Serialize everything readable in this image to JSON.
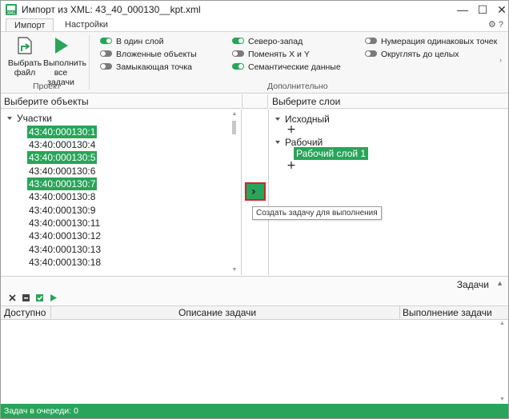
{
  "window": {
    "title": "Импорт из XML: 43_40_000130__kpt.xml",
    "minimize_glyph": "—",
    "maximize_glyph": "☐",
    "close_glyph": "✕"
  },
  "ribbon_tabs": [
    "Импорт",
    "Настройки"
  ],
  "ribbon_corner_icons": "⚙ ?",
  "project_group": {
    "label": "Проект",
    "choose_file": "Выбрать файл",
    "run_tasks": "Выполнить все задачи"
  },
  "additional_group": {
    "label": "Дополнительно",
    "toggles": [
      {
        "label": "В один слой",
        "on": true
      },
      {
        "label": "Вложенные объекты",
        "on": false
      },
      {
        "label": "Замыкающая точка",
        "on": false
      },
      {
        "label": "Северо-запад",
        "on": true
      },
      {
        "label": "Поменять X и Y",
        "on": false
      },
      {
        "label": "Семантические данные",
        "on": true
      },
      {
        "label": "Нумерация одинаковых точек",
        "on": false
      },
      {
        "label": "Округлять до целых",
        "on": false
      }
    ]
  },
  "objects_panel": {
    "header": "Выберите объекты",
    "root_label": "Участки",
    "parcels": [
      {
        "id": "43:40:000130:1",
        "selected": true
      },
      {
        "id": "43:40:000130:4",
        "selected": false
      },
      {
        "id": "43:40:000130:5",
        "selected": true
      },
      {
        "id": "43:40:000130:6",
        "selected": false
      },
      {
        "id": "43:40:000130:7",
        "selected": true
      },
      {
        "id": "43:40:000130:8",
        "selected": false
      },
      {
        "id": "43:40:000130:9",
        "selected": false
      },
      {
        "id": "43:40:000130:11",
        "selected": false
      },
      {
        "id": "43:40:000130:12",
        "selected": false
      },
      {
        "id": "43:40:000130:13",
        "selected": false
      },
      {
        "id": "43:40:000130:18",
        "selected": false
      }
    ]
  },
  "create_task": {
    "glyph": "›",
    "tooltip": "Создать задачу для выполнения"
  },
  "layers_panel": {
    "header": "Выберите слои",
    "groups": [
      {
        "name": "Исходный",
        "layers": []
      },
      {
        "name": "Рабочий",
        "layers": [
          "Рабочий слой 1"
        ]
      }
    ],
    "add_glyph": "+"
  },
  "tasks": {
    "title": "Задачи",
    "collapse_glyph": "▲",
    "columns": [
      "Доступно",
      "Описание задачи",
      "Выполнение задачи"
    ],
    "rows": []
  },
  "status": {
    "text": "Задач в очереди: 0"
  },
  "colors": {
    "accent_green": "#29a45a",
    "highlight_red": "#d4232a"
  }
}
